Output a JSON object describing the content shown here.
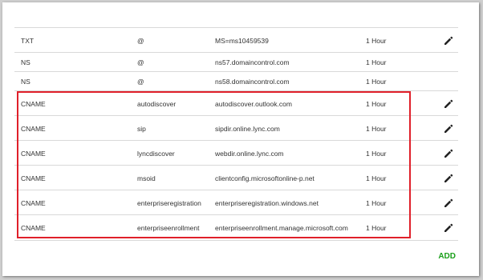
{
  "records": [
    {
      "type": "TXT",
      "name": "@",
      "value": "MS=ms10459539",
      "ttl": "1 Hour",
      "editable": true
    },
    {
      "type": "NS",
      "name": "@",
      "value": "ns57.domaincontrol.com",
      "ttl": "1 Hour",
      "editable": false
    },
    {
      "type": "NS",
      "name": "@",
      "value": "ns58.domaincontrol.com",
      "ttl": "1 Hour",
      "editable": false
    },
    {
      "type": "CNAME",
      "name": "autodiscover",
      "value": "autodiscover.outlook.com",
      "ttl": "1 Hour",
      "editable": true
    },
    {
      "type": "CNAME",
      "name": "sip",
      "value": "sipdir.online.lync.com",
      "ttl": "1 Hour",
      "editable": true
    },
    {
      "type": "CNAME",
      "name": "lyncdiscover",
      "value": "webdir.online.lync.com",
      "ttl": "1 Hour",
      "editable": true
    },
    {
      "type": "CNAME",
      "name": "msoid",
      "value": "clientconfig.microsoftonline-p.net",
      "ttl": "1 Hour",
      "editable": true
    },
    {
      "type": "CNAME",
      "name": "enterpriseregistration",
      "value": "enterpriseregistration.windows.net",
      "ttl": "1 Hour",
      "editable": true
    },
    {
      "type": "CNAME",
      "name": "enterpriseenrollment",
      "value": "enterpriseenrollment.manage.microsoft.com",
      "ttl": "1 Hour",
      "editable": true
    }
  ],
  "add_label": "ADD",
  "colors": {
    "highlight": "#e0202a",
    "add": "#1a9f1a",
    "divider": "#d9d9d9"
  },
  "icons": {
    "edit": "pencil-icon"
  }
}
